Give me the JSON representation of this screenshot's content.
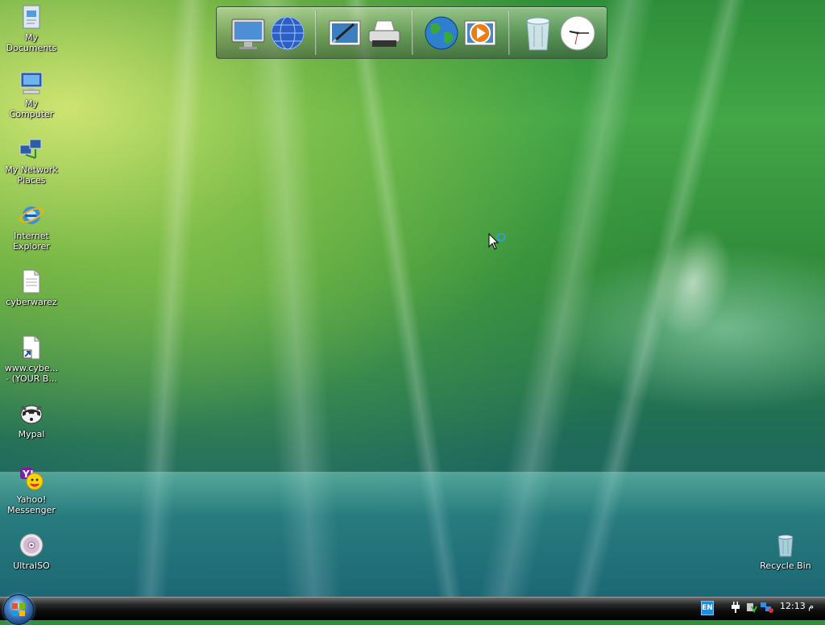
{
  "desktop": {
    "icons": [
      {
        "label": "My\nDocuments",
        "icon": "my-documents-icon"
      },
      {
        "label": "My\nComputer",
        "icon": "my-computer-icon"
      },
      {
        "label": "My Network\nPlaces",
        "icon": "network-places-icon"
      },
      {
        "label": "Internet\nExplorer",
        "icon": "internet-explorer-icon"
      },
      {
        "label": "cyberwarez",
        "icon": "text-file-icon"
      },
      {
        "label": "www.cybe...\n- (YOUR B...",
        "icon": "shortcut-file-icon"
      },
      {
        "label": "Mypal",
        "icon": "mypal-browser-icon"
      },
      {
        "label": "Yahoo!\nMessenger",
        "icon": "yahoo-messenger-icon"
      },
      {
        "label": "UltraISO",
        "icon": "ultraiso-disc-icon"
      }
    ],
    "recycle_bin": {
      "label": "Recycle Bin",
      "icon": "recycle-bin-icon"
    }
  },
  "dock": {
    "items": [
      "monitor-icon",
      "network-globe-icon",
      "picture-editor-icon",
      "printer-icon",
      "earth-globe-icon",
      "media-player-icon",
      "trash-can-icon",
      "clock-icon"
    ]
  },
  "taskbar": {
    "start_icon": "windows-logo-icon",
    "language": "EN",
    "tray_icons": [
      "power-plug-icon",
      "security-shield-icon",
      "network-connection-icon"
    ],
    "clock": "12:13 م"
  },
  "colors": {
    "taskbar": "#000000",
    "desktop_green": "#3aa043",
    "desktop_teal": "#1b6574"
  }
}
